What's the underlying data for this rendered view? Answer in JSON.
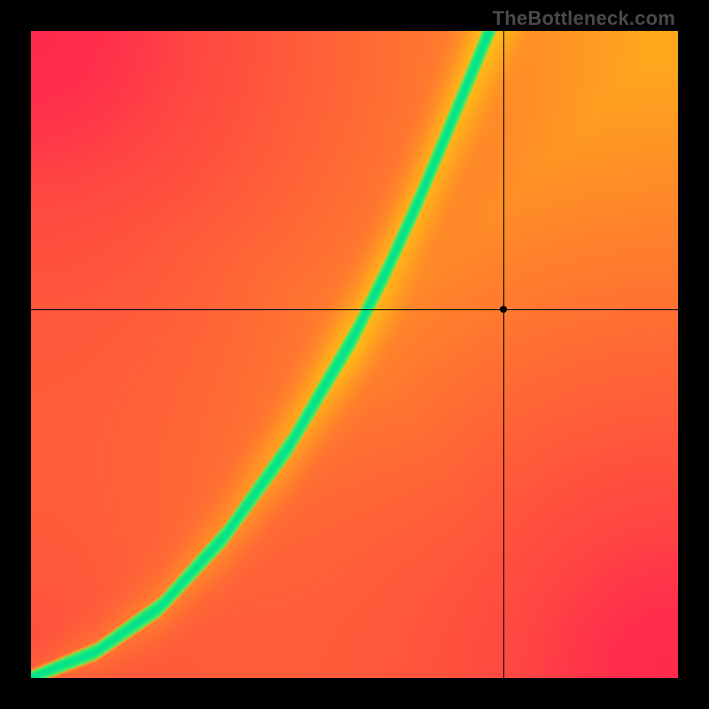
{
  "watermark": "TheBottleneck.com",
  "chart_data": {
    "type": "heatmap",
    "title": "",
    "xlabel": "",
    "ylabel": "",
    "xlim": [
      0,
      1
    ],
    "ylim": [
      0,
      1
    ],
    "grid": false,
    "legend": false,
    "crosshair": {
      "x": 0.73,
      "y": 0.57
    },
    "marker": {
      "x": 0.73,
      "y": 0.57
    },
    "color_stops": [
      {
        "value": 0.0,
        "color": "#ff2a4d"
      },
      {
        "value": 0.5,
        "color": "#fff200"
      },
      {
        "value": 1.0,
        "color": "#00e38c"
      }
    ],
    "optimal_curve_samples": [
      {
        "x": 0.0,
        "y": 0.0
      },
      {
        "x": 0.1,
        "y": 0.04
      },
      {
        "x": 0.2,
        "y": 0.11
      },
      {
        "x": 0.3,
        "y": 0.22
      },
      {
        "x": 0.4,
        "y": 0.36
      },
      {
        "x": 0.5,
        "y": 0.53
      },
      {
        "x": 0.55,
        "y": 0.63
      },
      {
        "x": 0.6,
        "y": 0.74
      },
      {
        "x": 0.65,
        "y": 0.86
      },
      {
        "x": 0.7,
        "y": 0.98
      }
    ],
    "sample_field_values": [
      {
        "x": 0.1,
        "y": 0.9,
        "score": 0.05
      },
      {
        "x": 0.9,
        "y": 0.9,
        "score": 0.55
      },
      {
        "x": 0.9,
        "y": 0.1,
        "score": 0.02
      },
      {
        "x": 0.1,
        "y": 0.1,
        "score": 0.3
      },
      {
        "x": 0.5,
        "y": 0.5,
        "score": 0.95
      },
      {
        "x": 0.73,
        "y": 0.57,
        "score": 0.35
      }
    ]
  }
}
